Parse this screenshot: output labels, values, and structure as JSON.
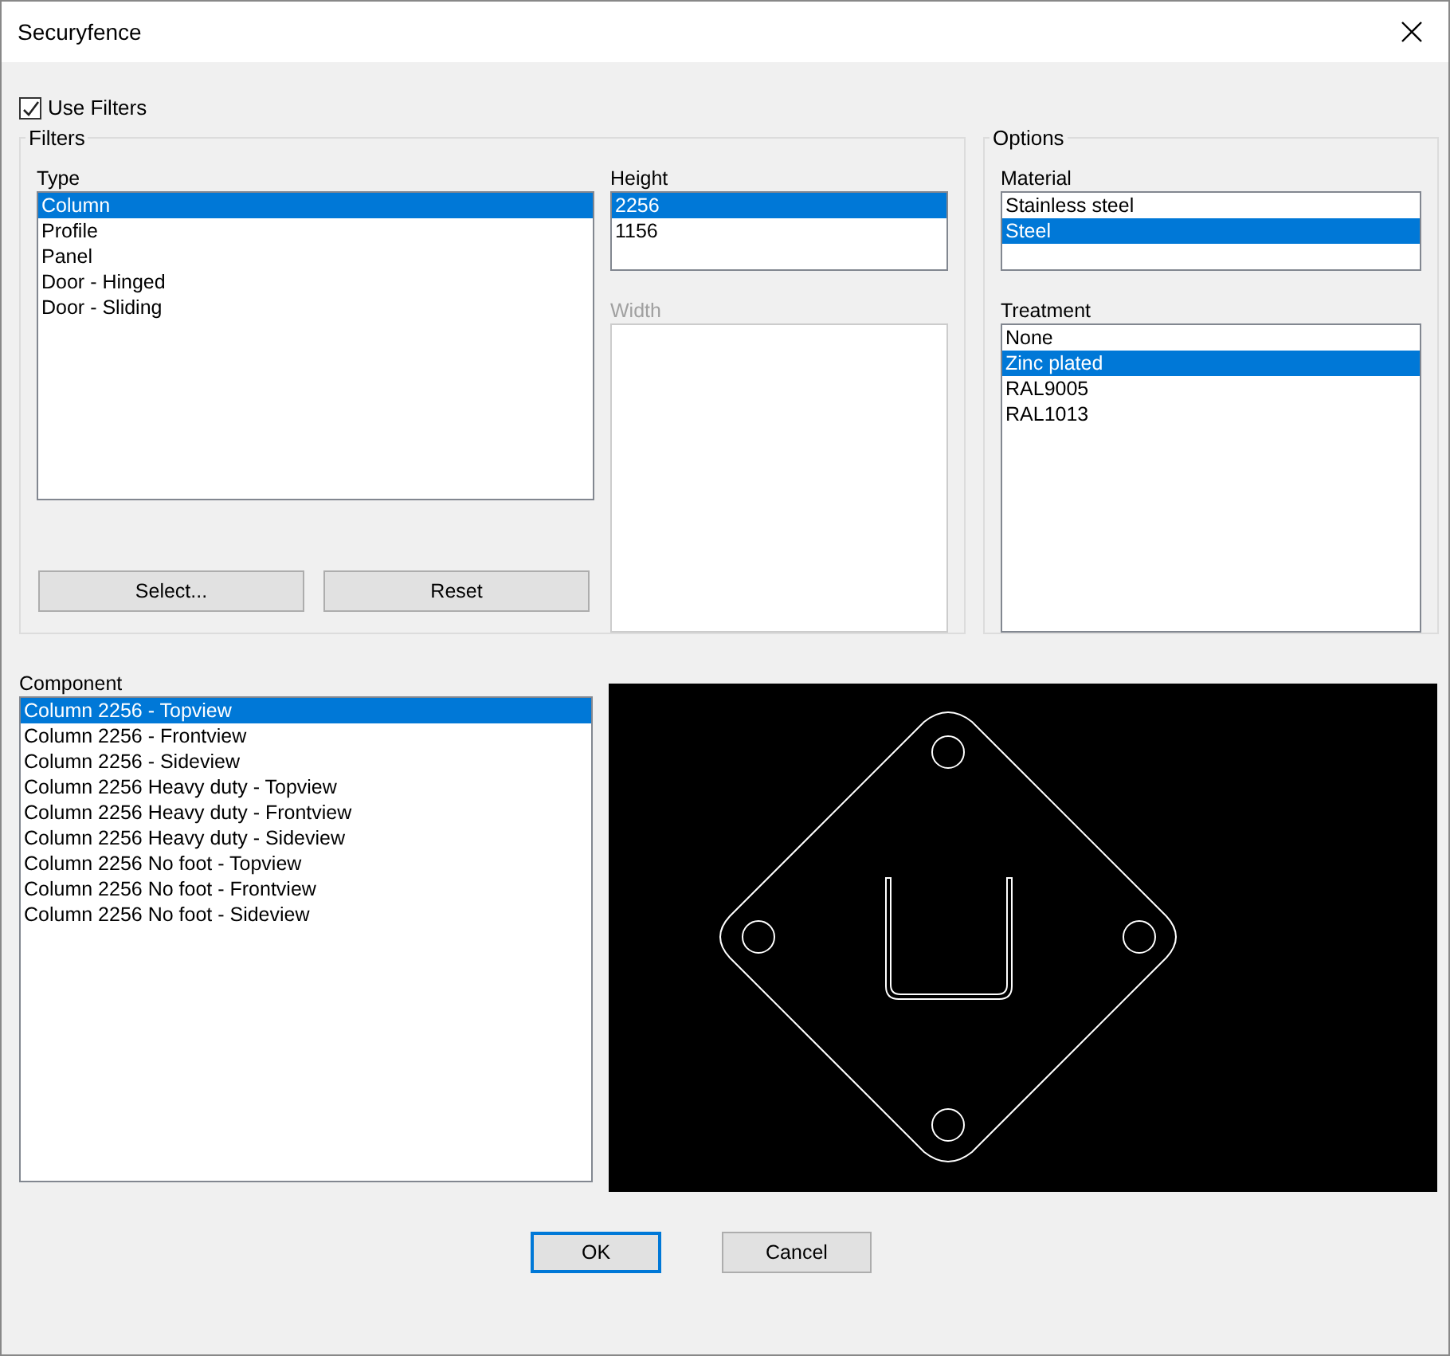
{
  "window": {
    "title": "Securyfence"
  },
  "use_filters": {
    "label": "Use Filters",
    "checked": true
  },
  "filters": {
    "title": "Filters",
    "type": {
      "label": "Type",
      "items": [
        {
          "text": "Column",
          "selected": true
        },
        {
          "text": "Profile",
          "selected": false
        },
        {
          "text": "Panel",
          "selected": false
        },
        {
          "text": "Door - Hinged",
          "selected": false
        },
        {
          "text": "Door - Sliding",
          "selected": false
        }
      ]
    },
    "height": {
      "label": "Height",
      "disabled": false,
      "items": [
        {
          "text": "2256",
          "selected": true
        },
        {
          "text": "1156",
          "selected": false
        }
      ]
    },
    "width": {
      "label": "Width",
      "disabled": true
    },
    "buttons": [
      "Select...",
      "Reset"
    ]
  },
  "options": {
    "title": "Options",
    "material": {
      "label": "Material",
      "items": [
        {
          "text": "Stainless steel",
          "selected": false
        },
        {
          "text": "Steel",
          "selected": true
        }
      ]
    },
    "treatment": {
      "label": "Treatment",
      "items": [
        {
          "text": "None",
          "selected": false
        },
        {
          "text": "Zinc plated",
          "selected": true
        },
        {
          "text": "RAL9005",
          "selected": false
        },
        {
          "text": "RAL1013",
          "selected": false
        }
      ]
    }
  },
  "component": {
    "label": "Component",
    "items": [
      {
        "text": "Column 2256 - Topview",
        "selected": true
      },
      {
        "text": "Column 2256 - Frontview",
        "selected": false
      },
      {
        "text": "Column 2256 - Sideview",
        "selected": false
      },
      {
        "text": "Column 2256 Heavy duty - Topview",
        "selected": false
      },
      {
        "text": "Column 2256 Heavy duty - Frontview",
        "selected": false
      },
      {
        "text": "Column 2256 Heavy duty - Sideview",
        "selected": false
      },
      {
        "text": "Column 2256 No foot - Topview",
        "selected": false
      },
      {
        "text": "Column 2256 No foot - Frontview",
        "selected": false
      },
      {
        "text": "Column 2256 No foot - Sideview",
        "selected": false
      }
    ]
  },
  "footer": {
    "buttons": [
      {
        "label": "OK",
        "default": true
      },
      {
        "label": "Cancel",
        "default": false
      }
    ]
  }
}
